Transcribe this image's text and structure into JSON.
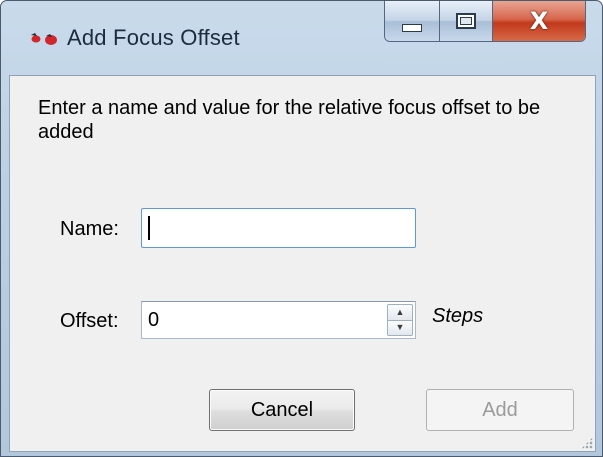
{
  "window": {
    "title": "Add Focus Offset",
    "icon": "focus-offset-app-icon",
    "caption_buttons": {
      "minimize_icon": "minimize-icon",
      "maximize_icon": "maximize-icon",
      "close_icon": "close-icon",
      "close_glyph": "X"
    }
  },
  "prompt": "Enter a name and value for the relative focus offset to be added",
  "form": {
    "name_label": "Name:",
    "name_value": "",
    "offset_label": "Offset:",
    "offset_value": "0",
    "offset_units": "Steps",
    "spinner_up_glyph": "▲",
    "spinner_down_glyph": "▼"
  },
  "buttons": {
    "cancel_label": "Cancel",
    "add_label": "Add",
    "add_enabled": false
  },
  "colors": {
    "focus_border": "#5b9bd5",
    "close_button": "#c2391c",
    "disabled_text": "#9b9b9b"
  }
}
